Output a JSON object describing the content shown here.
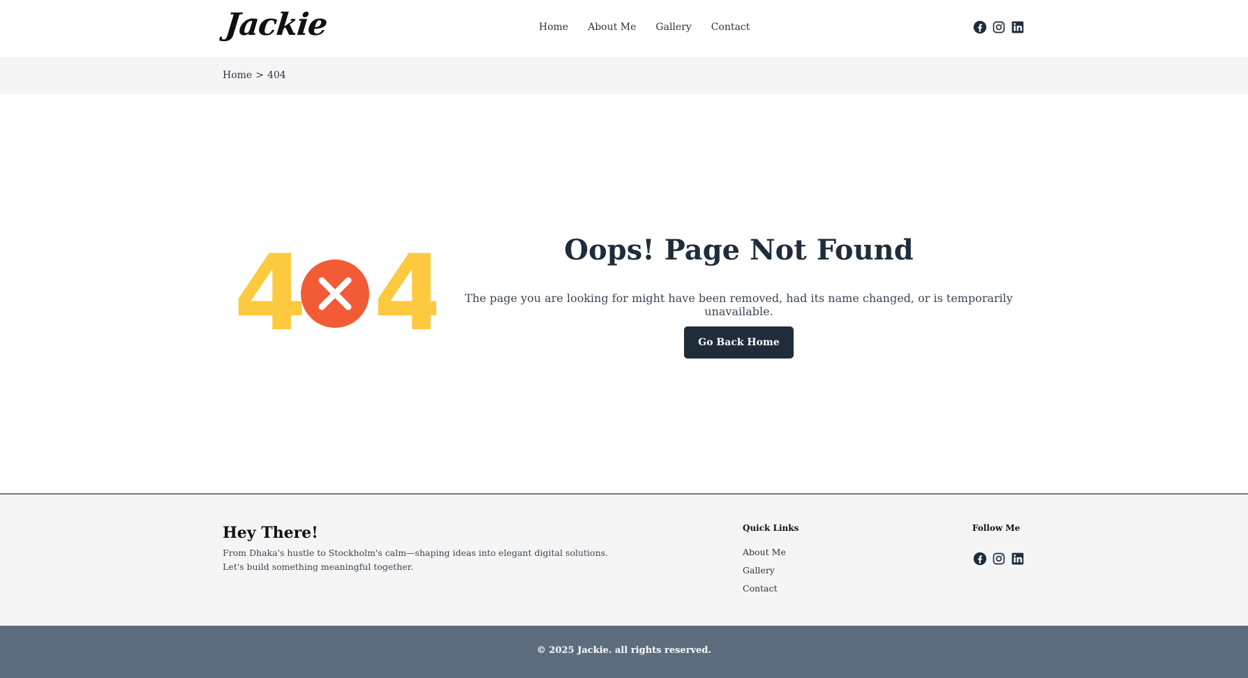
{
  "header": {
    "logo": "Jackie",
    "nav": [
      "Home",
      "About Me",
      "Gallery",
      "Contact"
    ],
    "social_icons": [
      "facebook-icon",
      "instagram-icon",
      "linkedin-icon"
    ]
  },
  "breadcrumb": {
    "home": "Home",
    "separator": ">",
    "current": "404"
  },
  "main": {
    "illustration_digits": [
      "4",
      "4"
    ],
    "title": "Oops! Page Not Found",
    "description": "The page you are looking for might have been removed, had its name changed, or is temporarily unavailable.",
    "button_label": "Go Back Home"
  },
  "footer": {
    "title": "Hey There!",
    "text_line1": "From Dhaka's hustle to Stockholm's calm—shaping ideas into elegant digital solutions.",
    "text_line2": "Let's build something meaningful together.",
    "quick_links_heading": "Quick Links",
    "quick_links": [
      "About Me",
      "Gallery",
      "Contact"
    ],
    "follow_heading": "Follow Me",
    "copyright": "© 2025 Jackie. all rights reserved."
  },
  "colors": {
    "primary_dark": "#1f2d3b",
    "accent_yellow": "#fcc93f",
    "accent_red": "#f25b35",
    "footer_bar": "#5e6d7e"
  }
}
